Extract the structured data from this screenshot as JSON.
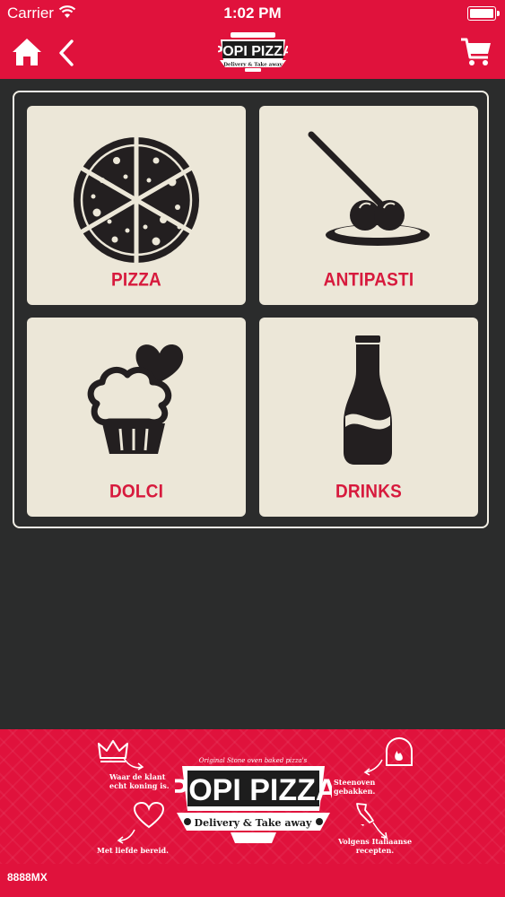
{
  "status_bar": {
    "carrier": "Carrier",
    "time": "1:02 PM",
    "battery_level": 1.0
  },
  "navbar": {
    "logo_name": "POPI PIZZA",
    "logo_tagline": "Delivery & Take away",
    "icons": {
      "home": "home-icon",
      "back": "chevron-left-icon",
      "cart": "shopping-cart-icon"
    }
  },
  "menu": {
    "tiles": [
      {
        "label": "PIZZA",
        "icon": "pizza-icon"
      },
      {
        "label": "ANTIPASTI",
        "icon": "antipasti-icon"
      },
      {
        "label": "DOLCI",
        "icon": "cupcake-icon"
      },
      {
        "label": "DRINKS",
        "icon": "bottle-icon"
      }
    ]
  },
  "footer": {
    "logo_name": "POPI PIZZA",
    "logo_tagline": "Delivery & Take away",
    "logo_subtitle": "Original Stone oven baked pizza's",
    "captions": [
      "Waar de klant echt koning is.",
      "Steenoven gebakken.",
      "Met liefde bereid.",
      "Volgens Italiaanse recepten."
    ]
  },
  "bottom_bar": {
    "code": "8888MX"
  },
  "colors": {
    "brand_red": "#e0123c",
    "background": "#2b2c2c",
    "tile": "#ece7d8",
    "label_red": "#d71a3d"
  }
}
